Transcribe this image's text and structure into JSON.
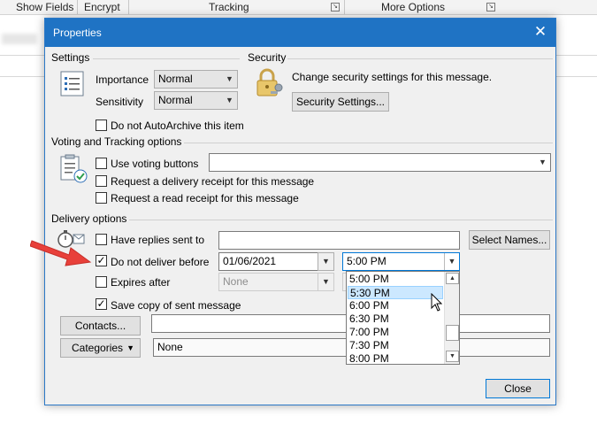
{
  "ribbon": {
    "show_fields": "Show Fields",
    "encrypt": "Encrypt",
    "tracking": "Tracking",
    "more_options": "More Options"
  },
  "dialog": {
    "title": "Properties",
    "close_glyph": "✕"
  },
  "settings": {
    "header": "Settings",
    "importance_label": "Importance",
    "importance_value": "Normal",
    "sensitivity_label": "Sensitivity",
    "sensitivity_value": "Normal",
    "no_autoarchive_label": "Do not AutoArchive this item",
    "no_autoarchive_checked": false
  },
  "security": {
    "header": "Security",
    "description": "Change security settings for this message.",
    "button": "Security Settings..."
  },
  "voting": {
    "header": "Voting and Tracking options",
    "use_voting_label": "Use voting buttons",
    "use_voting_checked": false,
    "voting_value": "",
    "delivery_receipt_label": "Request a delivery receipt for this message",
    "read_receipt_label": "Request a read receipt for this message"
  },
  "delivery": {
    "header": "Delivery options",
    "replies_label": "Have replies sent to",
    "replies_value": "",
    "select_names_button": "Select Names...",
    "no_deliver_label": "Do not deliver before",
    "no_deliver_checked": true,
    "no_deliver_date": "01/06/2021",
    "no_deliver_time": "5:00 PM",
    "expires_label": "Expires after",
    "expires_checked": false,
    "expires_date": "None",
    "save_copy_label": "Save copy of sent message",
    "save_copy_checked": true,
    "check_glyph": "✓"
  },
  "contacts": {
    "button": "Contacts...",
    "value": ""
  },
  "categories": {
    "button": "Categories",
    "value": "None"
  },
  "time_dropdown": {
    "options": [
      "5:00 PM",
      "5:30 PM",
      "6:00 PM",
      "6:30 PM",
      "7:00 PM",
      "7:30 PM",
      "8:00 PM"
    ],
    "highlighted": "5:30 PM"
  },
  "footer": {
    "close_button": "Close"
  },
  "colors": {
    "title_bar": "#1f73c4",
    "annotation_arrow": "#e8403a",
    "highlight": "#cce8ff"
  },
  "icons": [
    "settings-list-icon",
    "padlock-key-icon",
    "voting-clipboard-icon",
    "delivery-stopwatch-icon",
    "red-annotation-arrow",
    "mouse-pointer-icon"
  ]
}
